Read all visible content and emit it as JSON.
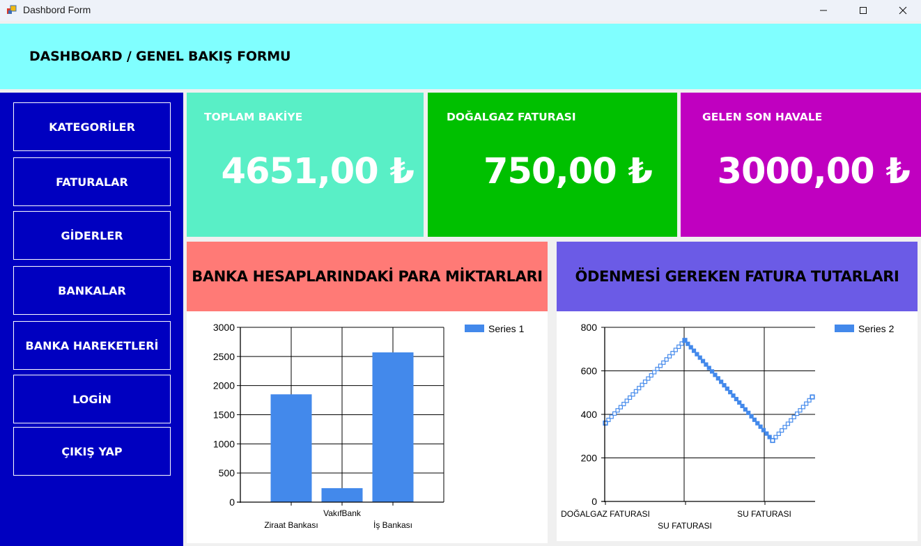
{
  "window": {
    "title": "Dashbord Form"
  },
  "header": {
    "title": "DASHBOARD / GENEL BAKIŞ FORMU"
  },
  "sidebar": {
    "items": [
      {
        "label": "KATEGORİLER"
      },
      {
        "label": "FATURALAR"
      },
      {
        "label": "GİDERLER"
      },
      {
        "label": "BANKALAR"
      },
      {
        "label": "BANKA HAREKETLERİ"
      },
      {
        "label": "LOGİN"
      },
      {
        "label": "ÇIKIŞ YAP"
      }
    ]
  },
  "cards": [
    {
      "label": "TOPLAM BAKİYE",
      "value": "4651,00 ₺",
      "color": "#59efc6"
    },
    {
      "label": "DOĞALGAZ FATURASI",
      "value": "750,00 ₺",
      "color": "#00c000"
    },
    {
      "label": "GELEN SON HAVALE",
      "value": "3000,00 ₺",
      "color": "#c000c0"
    }
  ],
  "panels": {
    "left_title": "BANKA HESAPLARINDAKİ PARA MİKTARLARI",
    "left_color": "#ff7a76",
    "right_title": "ÖDENMESİ GEREKEN FATURA TUTARLARI",
    "right_color": "#6b5be6"
  },
  "chart_data": [
    {
      "type": "bar",
      "categories": [
        "Ziraat Bankası",
        "VakıfBank",
        "İş Bankası"
      ],
      "series": [
        {
          "name": "Series 1",
          "values": [
            1850,
            240,
            2570
          ],
          "color": "#4389eb"
        }
      ],
      "ylim": [
        0,
        3000
      ],
      "yticks": [
        "0",
        "500",
        "1000",
        "1500",
        "2000",
        "2500",
        "3000"
      ],
      "grid": true,
      "legend": "top-right"
    },
    {
      "type": "line",
      "categories": [
        "DOĞALGAZ FATURASI",
        "SU FATURASI",
        "SU FATURASI"
      ],
      "series": [
        {
          "name": "Series 2",
          "values": [
            360,
            740,
            280,
            480
          ],
          "color": "#4389eb"
        }
      ],
      "ylim": [
        0,
        800
      ],
      "yticks": [
        "0",
        "200",
        "400",
        "600",
        "800"
      ],
      "grid": true,
      "legend": "top-right"
    }
  ]
}
